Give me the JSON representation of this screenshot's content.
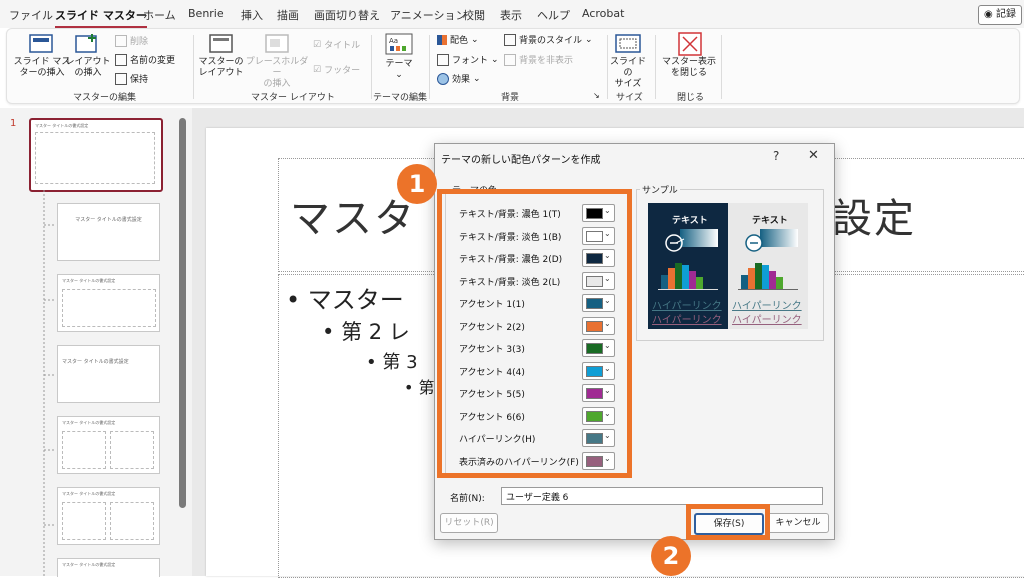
{
  "menubar": {
    "items": [
      "ファイル",
      "スライド マスター",
      "ホーム",
      "Benrie",
      "挿入",
      "描画",
      "画面切り替え",
      "アニメーション",
      "校閲",
      "表示",
      "ヘルプ",
      "Acrobat"
    ],
    "active_index": 1,
    "record_label": "記録"
  },
  "ribbon": {
    "groups": {
      "master_edit": {
        "label": "マスターの編集",
        "insert_master": "スライド マス\nターの挿入",
        "insert_layout": "レイアウト\nの挿入",
        "delete": "削除",
        "rename": "名前の変更",
        "preserve": "保持"
      },
      "master_layout": {
        "label": "マスター レイアウト",
        "master_layout_btn": "マスターの\nレイアウト",
        "insert_placeholder": "プレースホルダー\nの挿入",
        "title_check": "タイトル",
        "footer_check": "フッター"
      },
      "edit_theme": {
        "label": "テーマの編集",
        "theme_btn": "テーマ"
      },
      "background": {
        "label": "背景",
        "colors": "配色",
        "fonts": "フォント",
        "effects": "効果",
        "bg_styles": "背景のスタイル",
        "hide_bg": "背景を非表示"
      },
      "size": {
        "label": "サイズ",
        "slide_size": "スライドの\nサイズ"
      },
      "close": {
        "label": "閉じる",
        "close_master": "マスター表示\nを閉じる"
      }
    }
  },
  "thumbnails": {
    "slide_number": "1",
    "master_title": "マスター タイトルの書式設定",
    "layout_title": "マスター タイトルの書式設定"
  },
  "slide": {
    "title_left": "マスタ",
    "title_right": "設定",
    "bullets": [
      "マスター",
      "第 2 レ",
      "第 3",
      "第"
    ]
  },
  "dialog": {
    "title": "テーマの新しい配色パターンを作成",
    "help": "?",
    "close": "✕",
    "theme_colors_caption": "テーマの色",
    "sample_caption": "サンプル",
    "colors": [
      {
        "label": "テキスト/背景: 濃色 1(T)",
        "color": "#000000"
      },
      {
        "label": "テキスト/背景: 淡色 1(B)",
        "color": "#ffffff"
      },
      {
        "label": "テキスト/背景: 濃色 2(D)",
        "color": "#0e2841"
      },
      {
        "label": "テキスト/背景: 淡色 2(L)",
        "color": "#e8e8e8"
      },
      {
        "label": "アクセント 1(1)",
        "color": "#156082"
      },
      {
        "label": "アクセント 2(2)",
        "color": "#e97132"
      },
      {
        "label": "アクセント 3(3)",
        "color": "#196b24"
      },
      {
        "label": "アクセント 4(4)",
        "color": "#0f9ed5"
      },
      {
        "label": "アクセント 5(5)",
        "color": "#a02b93"
      },
      {
        "label": "アクセント 6(6)",
        "color": "#4ea72e"
      },
      {
        "label": "ハイパーリンク(H)",
        "color": "#467886"
      },
      {
        "label": "表示済みのハイパーリンク(F)",
        "color": "#96607d"
      }
    ],
    "sample": {
      "text": "テキスト",
      "hyperlink": "ハイパーリンク",
      "dark_bg": "#0e2841",
      "light_bg": "#e8e8e8"
    },
    "name_label": "名前(N):",
    "name_value": "ユーザー定義 6",
    "reset_label": "リセット(R)",
    "save_label": "保存(S)",
    "cancel_label": "キャンセル"
  },
  "annotations": {
    "step1": "1",
    "step2": "2",
    "accent": "#ec7329"
  }
}
